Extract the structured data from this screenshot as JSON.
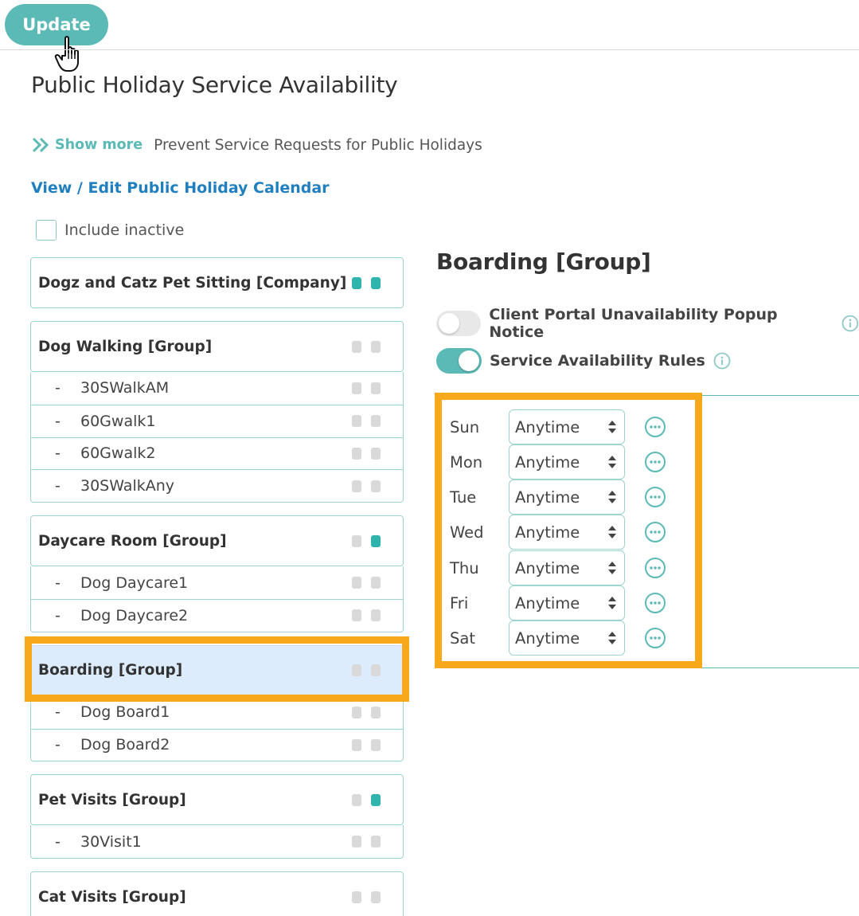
{
  "toolbar": {
    "update_label": "Update"
  },
  "page_title": "Public Holiday Service Availability",
  "show_more": {
    "link_label": "Show more",
    "description": "Prevent Service Requests for Public Holidays"
  },
  "calendar_link": "View / Edit Public Holiday Calendar",
  "include_inactive": {
    "label": "Include inactive",
    "checked": false
  },
  "groups": [
    {
      "name": "Dogz and Catz Pet Sitting [Company]",
      "flags": [
        true,
        true
      ],
      "selected": false,
      "subs": []
    },
    {
      "name": "Dog Walking [Group]",
      "flags": [
        false,
        false
      ],
      "selected": false,
      "subs": [
        {
          "dash": "-",
          "name": "30SWalkAM"
        },
        {
          "dash": "-",
          "name": "60Gwalk1"
        },
        {
          "dash": "-",
          "name": "60Gwalk2"
        },
        {
          "dash": "-",
          "name": "30SWalkAny"
        }
      ]
    },
    {
      "name": "Daycare Room [Group]",
      "flags": [
        false,
        true
      ],
      "selected": false,
      "subs": [
        {
          "dash": "-",
          "name": "Dog Daycare1"
        },
        {
          "dash": "-",
          "name": "Dog Daycare2"
        }
      ]
    },
    {
      "name": "Boarding [Group]",
      "flags": [
        false,
        false
      ],
      "selected": true,
      "subs": [
        {
          "dash": "-",
          "name": "Dog Board1"
        },
        {
          "dash": "-",
          "name": "Dog Board2"
        }
      ]
    },
    {
      "name": "Pet Visits [Group]",
      "flags": [
        false,
        true
      ],
      "selected": false,
      "subs": [
        {
          "dash": "-",
          "name": "30Visit1"
        }
      ]
    },
    {
      "name": "Cat Visits [Group]",
      "flags": [
        false,
        false
      ],
      "selected": false,
      "subs": []
    }
  ],
  "detail": {
    "title": "Boarding [Group]",
    "portal_notice": {
      "label": "Client Portal Unavailability Popup Notice",
      "enabled": false
    },
    "availability_rules": {
      "label": "Service Availability Rules",
      "enabled": true
    },
    "days": [
      {
        "day": "Sun",
        "value": "Anytime"
      },
      {
        "day": "Mon",
        "value": "Anytime"
      },
      {
        "day": "Tue",
        "value": "Anytime"
      },
      {
        "day": "Wed",
        "value": "Anytime"
      },
      {
        "day": "Thu",
        "value": "Anytime"
      },
      {
        "day": "Fri",
        "value": "Anytime"
      },
      {
        "day": "Sat",
        "value": "Anytime"
      }
    ]
  },
  "colors": {
    "accent": "#5bbab5",
    "flag_on": "#2fb3ad",
    "link": "#1f7fbf",
    "highlight": "#f7a81b",
    "selected_bg": "#dcecfc"
  }
}
